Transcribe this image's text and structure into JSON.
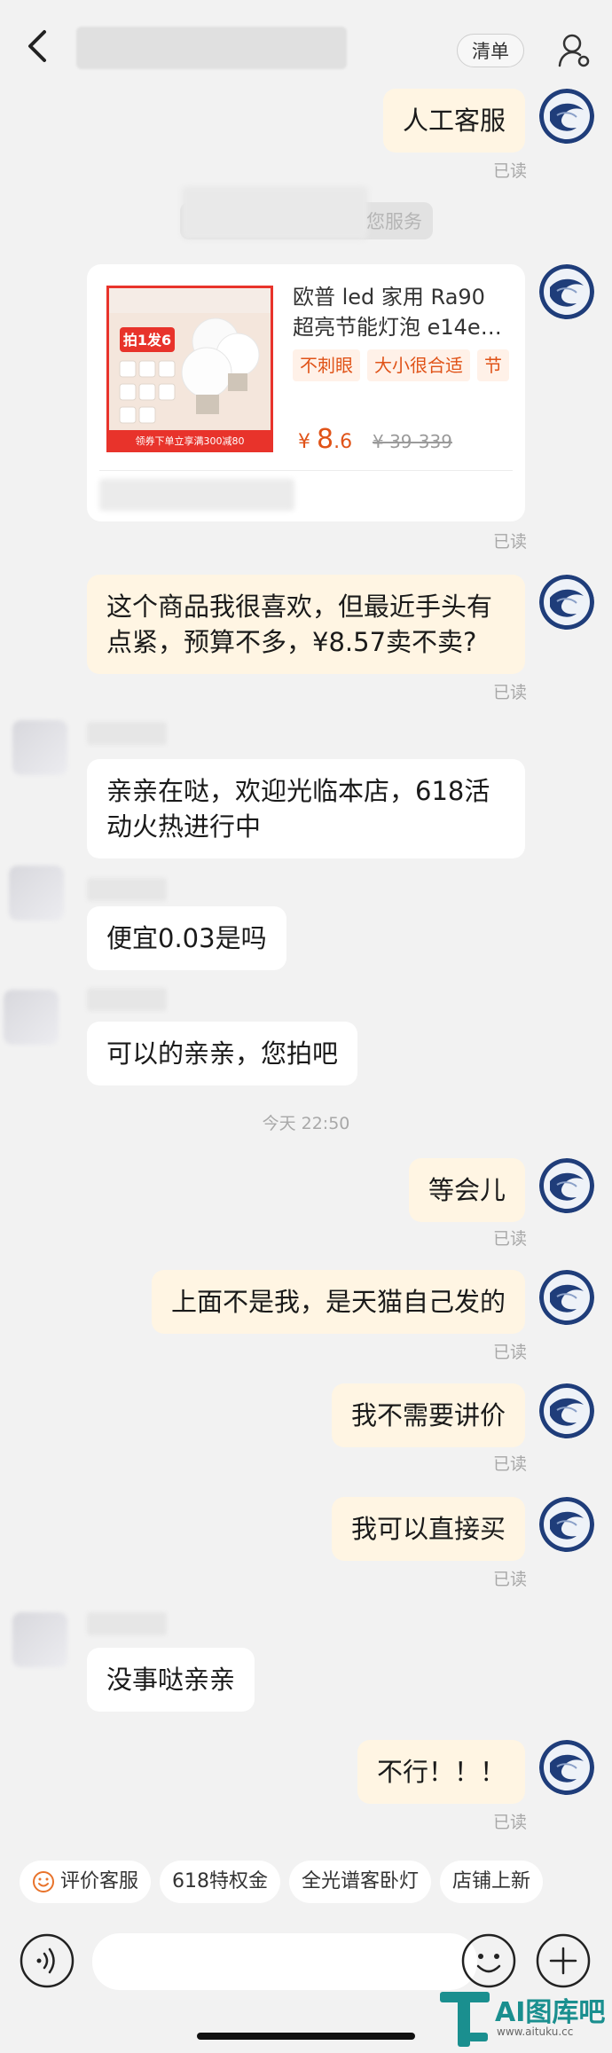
{
  "header": {
    "list_label": "清单",
    "icons": {
      "back": "chevron-left-icon",
      "user": "user-settings-icon"
    }
  },
  "messages": {
    "m1": {
      "text": "人工客服",
      "read": "已读"
    },
    "system_notice": "您服务",
    "product": {
      "title": "欧普 led 家用 Ra90 超亮节能灯泡 e14e…",
      "title_line1": "欧普 led 家用 Ra90",
      "title_line2": "超亮节能灯泡 e14e…",
      "tags": [
        "不刺眼",
        "大小很合适",
        "节"
      ],
      "price_symbol": "¥",
      "price_int": "8",
      "price_dec": ".6",
      "original_price": "¥ 39-339",
      "image_badge": "拍1发6",
      "image_footer": "领券下单立享满300减80",
      "read": "已读"
    },
    "m2": {
      "line1": "这个商品我很喜欢，但最近手头有",
      "line2": "点紧，预算不多，¥8.57卖不卖?",
      "read": "已读"
    },
    "m3": {
      "line1": "亲亲在哒，欢迎光临本店，618活",
      "line2": "动火热进行中"
    },
    "m4": {
      "text": "便宜0.03是吗"
    },
    "m5": {
      "text": "可以的亲亲，您拍吧"
    },
    "timestamp": "今天 22:50",
    "m6": {
      "text": "等会儿",
      "read": "已读"
    },
    "m7": {
      "text": "上面不是我，是天猫自己发的",
      "read": "已读"
    },
    "m8": {
      "text": "我不需要讲价",
      "read": "已读"
    },
    "m9": {
      "text": "我可以直接买",
      "read": "已读"
    },
    "m10": {
      "text": "没事哒亲亲"
    },
    "m11": {
      "text": "不行！！！",
      "read": "已读"
    }
  },
  "quick_replies": [
    "评价客服",
    "618特权金",
    "全光谱客卧灯",
    "店铺上新"
  ],
  "input": {
    "placeholder": "",
    "icons": {
      "voice": "voice-icon",
      "emoji": "emoji-icon",
      "plus": "plus-icon",
      "smile": "smile-icon"
    }
  },
  "watermark": {
    "text": "AI图库吧",
    "url": "www.aituku.cc"
  },
  "colors": {
    "bubble_right": "#fff5e3",
    "bubble_left": "#ffffff",
    "accent": "#e05318",
    "background": "#f2f2f2"
  }
}
